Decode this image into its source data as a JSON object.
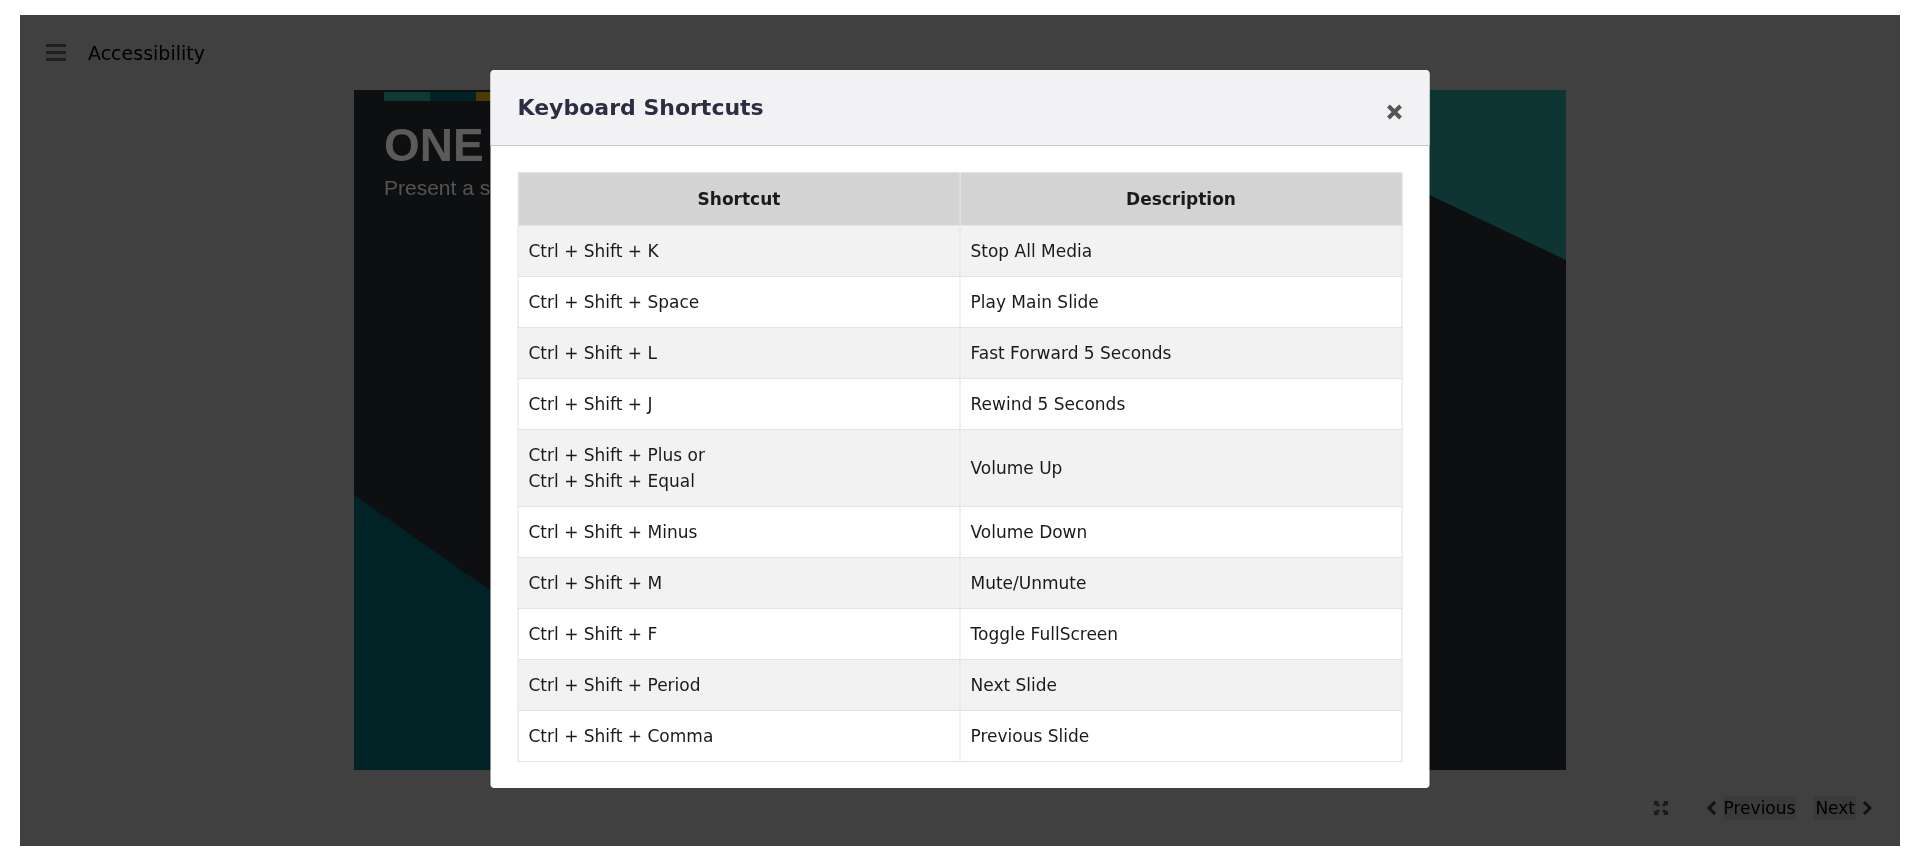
{
  "header": {
    "title": "Accessibility"
  },
  "slide": {
    "title": "ONE",
    "subtitle": "Present a s"
  },
  "nav": {
    "previous": "Previous",
    "next": "Next"
  },
  "dialog": {
    "title": "Keyboard Shortcuts",
    "columns": [
      "Shortcut",
      "Description"
    ],
    "rows": [
      {
        "shortcut": [
          "Ctrl + Shift + K"
        ],
        "description": "Stop All Media"
      },
      {
        "shortcut": [
          "Ctrl + Shift + Space"
        ],
        "description": "Play Main Slide"
      },
      {
        "shortcut": [
          "Ctrl + Shift + L"
        ],
        "description": "Fast Forward 5 Seconds"
      },
      {
        "shortcut": [
          "Ctrl + Shift + J"
        ],
        "description": "Rewind 5 Seconds"
      },
      {
        "shortcut": [
          "Ctrl + Shift + Plus or",
          "Ctrl + Shift + Equal"
        ],
        "description": "Volume Up"
      },
      {
        "shortcut": [
          "Ctrl + Shift + Minus"
        ],
        "description": "Volume Down"
      },
      {
        "shortcut": [
          "Ctrl + Shift + M"
        ],
        "description": "Mute/Unmute"
      },
      {
        "shortcut": [
          "Ctrl + Shift + F"
        ],
        "description": "Toggle FullScreen"
      },
      {
        "shortcut": [
          "Ctrl + Shift + Period"
        ],
        "description": "Next Slide"
      },
      {
        "shortcut": [
          "Ctrl + Shift + Comma"
        ],
        "description": "Previous Slide"
      }
    ]
  }
}
